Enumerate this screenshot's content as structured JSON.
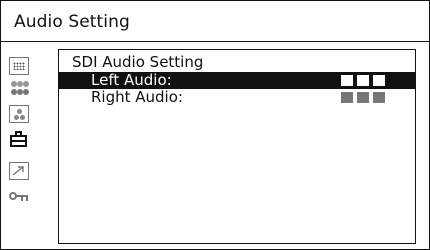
{
  "window": {
    "title": "Audio Setting"
  },
  "sidebar": {
    "icons": [
      {
        "name": "status-icon"
      },
      {
        "name": "color-temp-icon"
      },
      {
        "name": "function-icon"
      },
      {
        "name": "audio-setting-icon",
        "selected": true
      },
      {
        "name": "tool-icon"
      },
      {
        "name": "key-lock-icon"
      }
    ]
  },
  "menu": {
    "header": "SDI Audio Setting",
    "items": [
      {
        "label": "Left Audio:",
        "selected": true,
        "level_blocks": 3
      },
      {
        "label": "Right Audio:",
        "selected": false,
        "level_blocks": 3
      }
    ]
  },
  "colors": {
    "foreground": "#111111",
    "background": "#ffffff",
    "inactive_block": "#777777"
  }
}
